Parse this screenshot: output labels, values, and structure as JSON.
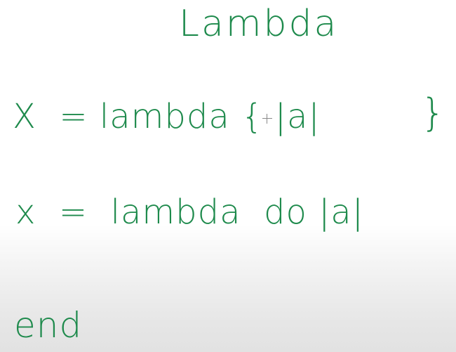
{
  "board": {
    "title": "Lambda",
    "line1": "X  = lambda { |a|",
    "line1_close": "}",
    "line2": "x  =  lambda  do |a|",
    "line3": "end"
  },
  "colors": {
    "ink": "#1e8a4c",
    "background": "#ffffff"
  }
}
